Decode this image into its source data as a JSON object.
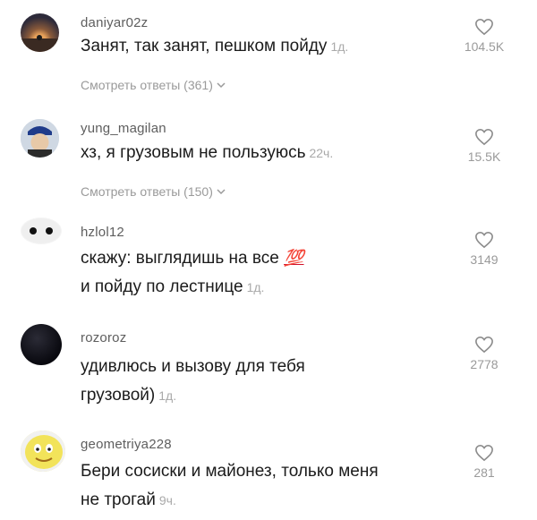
{
  "comments": [
    {
      "username": "daniyar02z",
      "lines": [
        "Занят, так занят, пешком пойду"
      ],
      "time": "1д.",
      "likes": "104.5K",
      "replies": "Смотреть ответы (361)"
    },
    {
      "username": "yung_magilan",
      "lines": [
        "хз, я грузовым не пользуюсь"
      ],
      "time": "22ч.",
      "likes": "15.5K",
      "replies": "Смотреть ответы (150)"
    },
    {
      "username": "hzlol12",
      "lines": [
        "скажу: выглядишь на все",
        "и пойду по лестнице"
      ],
      "emoji": "💯",
      "time": "1д.",
      "likes": "3149"
    },
    {
      "username": "rozoroz",
      "lines": [
        "удивлюсь и вызову для тебя",
        "грузовой)"
      ],
      "time": "1д.",
      "likes": "2778"
    },
    {
      "username": "geometriya228",
      "lines": [
        "Бери сосиски и майонез, только меня",
        "не трогай"
      ],
      "time": "9ч.",
      "likes": "281"
    }
  ]
}
